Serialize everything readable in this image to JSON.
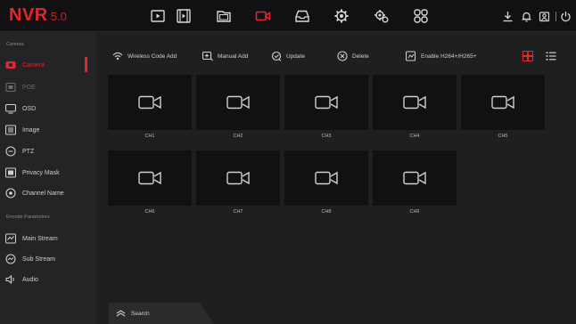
{
  "app": {
    "brand": "NVR",
    "version": "5.0"
  },
  "colors": {
    "accent": "#e3262e",
    "background": "#1f1f21",
    "topbar": "#111113",
    "sidebar": "#242426",
    "tile": "#111112"
  },
  "topnav": {
    "icons": [
      {
        "name": "live-view-icon"
      },
      {
        "name": "playback-icon"
      },
      {
        "name": "file-management-icon"
      },
      {
        "name": "camera-icon",
        "active": true
      },
      {
        "name": "storage-icon"
      },
      {
        "name": "system-settings-icon"
      },
      {
        "name": "advanced-settings-icon"
      },
      {
        "name": "channel-layout-icon"
      }
    ],
    "right_icons": [
      "download-icon",
      "alarm-bell-icon",
      "account-icon",
      "power-icon"
    ]
  },
  "sidebar": {
    "section_camera": "Camera",
    "section_encode": "Encode Parameters",
    "items": [
      {
        "label": "Camera",
        "icon": "camera-icon",
        "state": "active"
      },
      {
        "label": "POE",
        "icon": "poe-icon",
        "state": "disabled"
      },
      {
        "label": "OSD",
        "icon": "osd-icon",
        "state": "normal"
      },
      {
        "label": "Image",
        "icon": "image-icon",
        "state": "normal"
      },
      {
        "label": "PTZ",
        "icon": "ptz-icon",
        "state": "normal"
      },
      {
        "label": "Privacy Mask",
        "icon": "privacy-mask-icon",
        "state": "normal"
      },
      {
        "label": "Channel Name",
        "icon": "channel-name-icon",
        "state": "normal"
      }
    ],
    "encode_items": [
      {
        "label": "Main Stream",
        "icon": "main-stream-icon"
      },
      {
        "label": "Sub Stream",
        "icon": "sub-stream-icon"
      },
      {
        "label": "Audio",
        "icon": "audio-icon"
      }
    ]
  },
  "toolbar": {
    "wireless_code_add": "Wireless Code Add",
    "manual_add": "Manual Add",
    "update": "Update",
    "delete": "Delete",
    "enable_h264": "Enable H264+/H265+"
  },
  "channels": [
    "CH1",
    "CH2",
    "CH3",
    "CH4",
    "CH5",
    "CH6",
    "CH7",
    "CH8",
    "CH9"
  ],
  "search": {
    "label": "Search"
  }
}
